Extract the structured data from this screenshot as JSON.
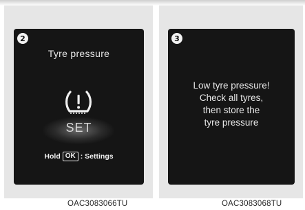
{
  "panels": [
    {
      "step": "2",
      "title": "Tyre pressure",
      "icon": "tpms-warning-icon",
      "set_label": "SET",
      "hint": {
        "hold": "Hold",
        "key": "OK",
        "action": ": Settings"
      },
      "caption": "OAC3083066TU"
    },
    {
      "step": "3",
      "message_lines": [
        "Low tyre pressure!",
        "Check all tyres,",
        "then store the",
        "tyre pressure"
      ],
      "caption": "OAC3083068TU"
    }
  ],
  "colors": {
    "panel_bg": "#e6e6e6",
    "screen_bg": "#151515",
    "screen_text": "#e8e8e8",
    "badge_bg": "#f2f2f2"
  }
}
